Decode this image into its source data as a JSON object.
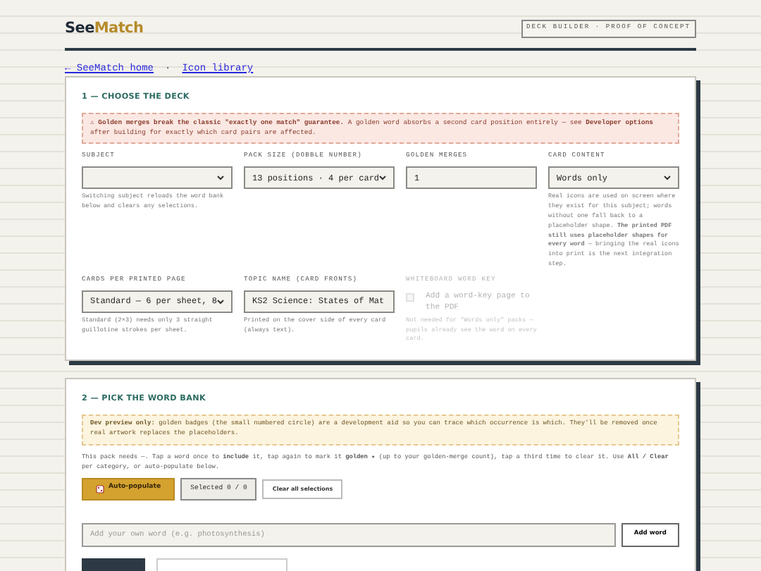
{
  "header": {
    "logo_dark": "See",
    "logo_accent": "Match",
    "badge": "DECK BUILDER · PROOF OF CONCEPT"
  },
  "nav_links": [
    {
      "label": "← SeeMatch home"
    },
    {
      "label": "Icon library"
    }
  ],
  "nav_separator": "·",
  "deck_section": {
    "title": "1 — CHOOSE THE DECK",
    "alert": "⚠ **Golden merges break the classic \"exactly one match\" guarantee.** A golden word absorbs a second card position entirely — see **Developer options** after building for exactly which card pairs are affected.",
    "fields": [
      {
        "kind": "select",
        "label": "SUBJECT",
        "hint": "Switching subject reloads the word bank below and clears any selections.",
        "disabled": false
      },
      {
        "kind": "select",
        "label": "PACK SIZE (DOBBLE NUMBER)",
        "value": "13 positions · 4 per card",
        "disabled": false
      },
      {
        "kind": "input",
        "label": "GOLDEN MERGES",
        "value": "1",
        "disabled": false
      },
      {
        "kind": "select",
        "label": "CARD CONTENT",
        "value": "Words only",
        "hint": "Real icons are used on screen where they exist for this subject; words without one fall back to a placeholder shape. **The printed PDF still uses placeholder shapes for every word** — bringing the real icons into print is the next integration step.",
        "disabled": false
      },
      {
        "kind": "select",
        "label": "CARDS PER PRINTED PAGE",
        "value": "Standard — 6 per sheet, 8",
        "hint": "Standard (2×3) needs only 3 straight guillotine strokes per sheet.",
        "disabled": false
      },
      {
        "kind": "input",
        "label": "TOPIC NAME (CARD FRONTS)",
        "value": "KS2 Science: States of Mat",
        "hint": "Printed on the cover side of every card (always text).",
        "disabled": false
      },
      {
        "kind": "checkbox",
        "label": "WHITEBOARD WORD KEY",
        "value": "Add a word-key page to the PDF",
        "checked": false,
        "hint": "Not needed for \"Words only\" packs — pupils already see the word on every card.",
        "disabled": true
      }
    ]
  },
  "word_section": {
    "title": "2 — PICK THE WORD BANK",
    "alert": "**Dev preview only:** golden badges (the small numbered circle) are a development aid so you can trace which occurrence is which. They'll be removed once real artwork replaces the placeholders.",
    "instructions": "This pack needs —. Tap a word once to **include** it, tap again to mark it **golden ★** (up to your golden-merge count), tap a third time to clear it. Use **All / Clear** per category, or auto-populate below.",
    "buttons": [
      {
        "kind": "primary",
        "label": "Auto-populate"
      },
      {
        "kind": "counter",
        "label": "Selected 0 / 0"
      },
      {
        "kind": "outline",
        "label": "Clear all selections"
      }
    ],
    "add_word": {
      "placeholder": "Add your own word (e.g. photosynthesis)",
      "button": "Add word"
    }
  }
}
